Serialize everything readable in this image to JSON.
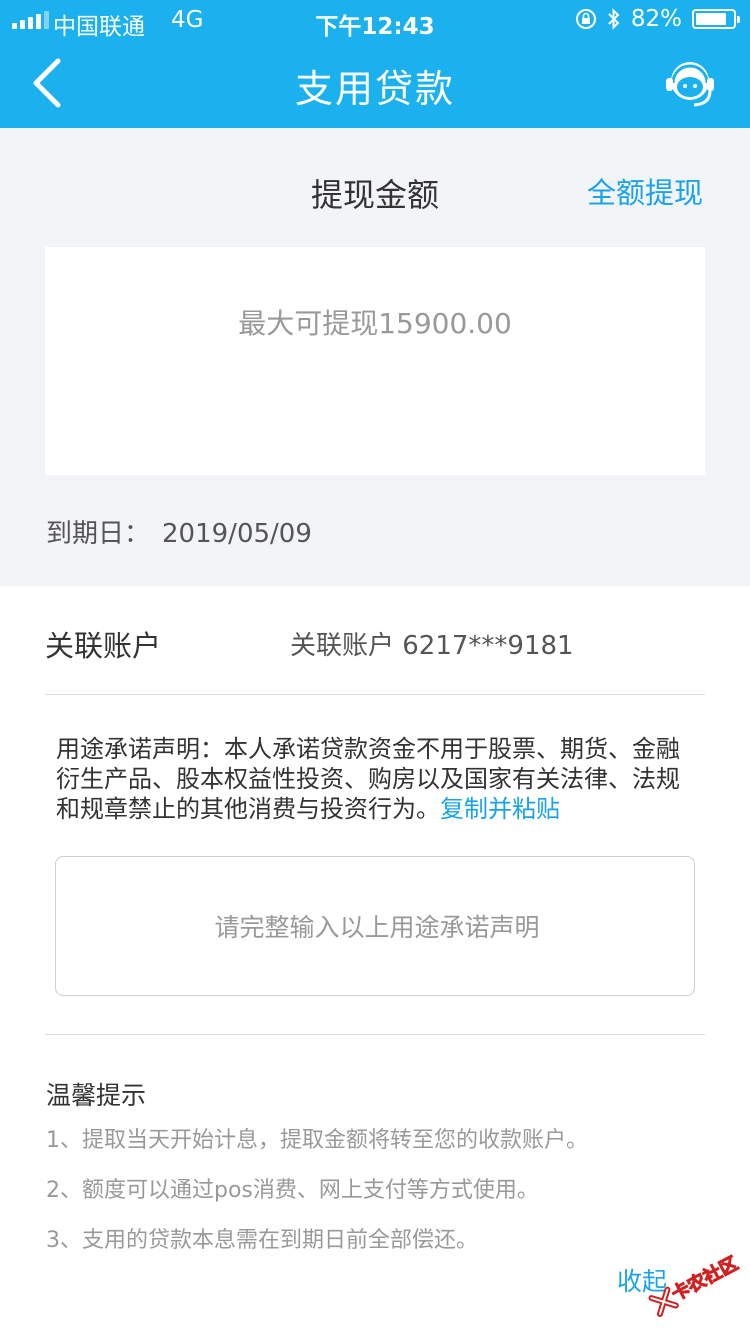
{
  "status_bar": {
    "carrier": "中国联通",
    "network": "4G",
    "time": "下午12:43",
    "battery_text": "82%",
    "battery_level": 0.82
  },
  "nav": {
    "title": "支用贷款",
    "back_icon": "chevron-left-icon",
    "service_icon": "customer-service-icon"
  },
  "amount": {
    "title": "提现金额",
    "full_withdraw_label": "全额提现",
    "placeholder": "最大可提现15900.00"
  },
  "due": {
    "label": "到期日：",
    "value": "2019/05/09"
  },
  "account": {
    "label": "关联账户",
    "value": "关联账户 6217***9181"
  },
  "declaration": {
    "text": "用途承诺声明：本人承诺贷款资金不用于股票、期货、金融衍生产品、股本权益性投资、购房以及国家有关法律、法规和规章禁止的其他消费与投资行为。",
    "copy_label": "复制并粘贴",
    "input_placeholder": "请完整输入以上用途承诺声明"
  },
  "tips": {
    "title": "温馨提示",
    "items": [
      "1、提取当天开始计息，提取金额将转至您的收款账户。",
      "2、额度可以通过pos消费、网上支付等方式使用。",
      "3、支用的贷款本息需在到期日前全部偿还。"
    ]
  },
  "collapse_label": "收起",
  "watermark_text": "卡农社区",
  "colors": {
    "brand": "#1ab1ee",
    "link": "#1aa3e8",
    "section_bg": "#f2f4f7"
  }
}
